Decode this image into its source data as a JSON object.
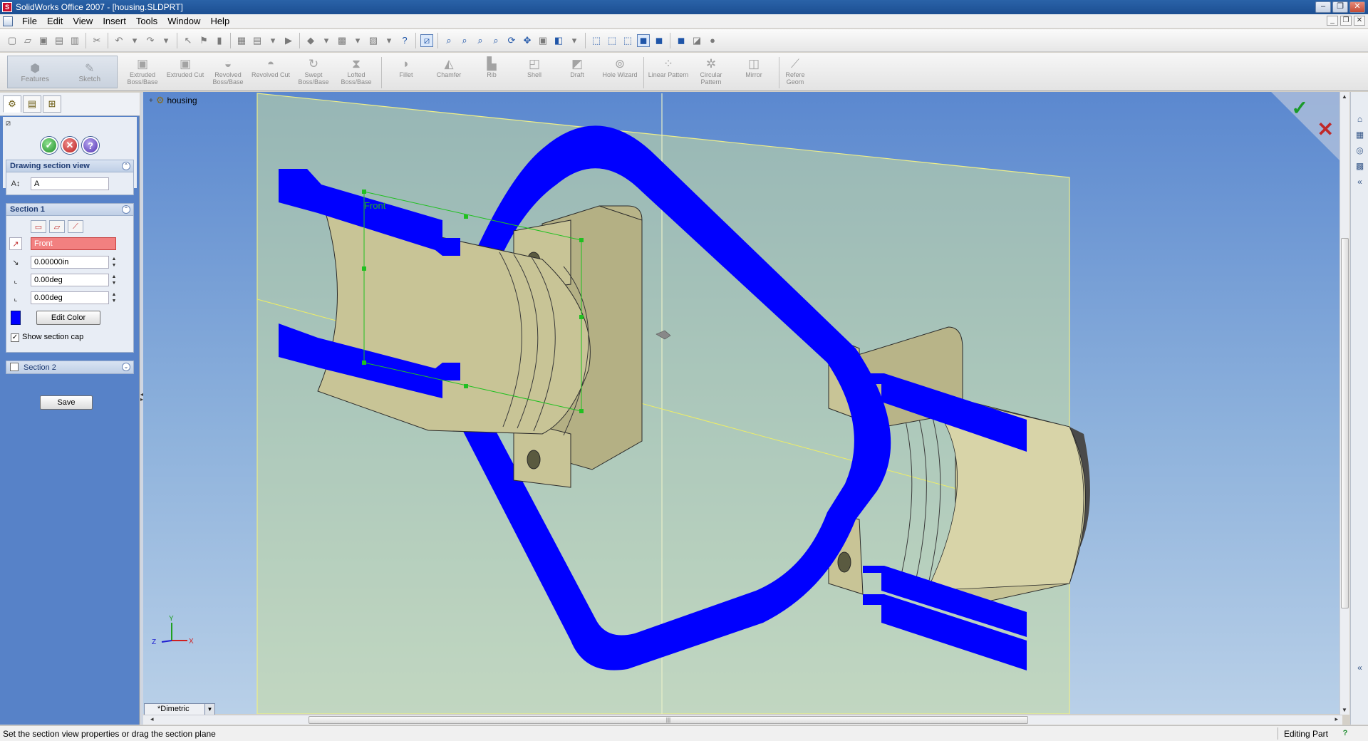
{
  "window": {
    "title": "SolidWorks Office 2007 - [housing.SLDPRT]",
    "app_icon": "solidworks-logo-icon",
    "controls": [
      "minimize-icon",
      "restore-icon",
      "close-icon"
    ]
  },
  "menu": {
    "items": [
      "File",
      "Edit",
      "View",
      "Insert",
      "Tools",
      "Window",
      "Help"
    ]
  },
  "command_manager": {
    "tabs": [
      {
        "label": "Features",
        "icon": "features-icon"
      },
      {
        "label": "Sketch",
        "icon": "sketch-icon"
      }
    ],
    "buttons": [
      {
        "label": "Extruded Boss/Base",
        "icon": "extruded-boss-icon"
      },
      {
        "label": "Extruded Cut",
        "icon": "extruded-cut-icon"
      },
      {
        "label": "Revolved Boss/Base",
        "icon": "revolved-boss-icon"
      },
      {
        "label": "Revolved Cut",
        "icon": "revolved-cut-icon"
      },
      {
        "label": "Swept Boss/Base",
        "icon": "swept-boss-icon"
      },
      {
        "label": "Lofted Boss/Base",
        "icon": "lofted-boss-icon"
      },
      {
        "label": "Fillet",
        "icon": "fillet-icon"
      },
      {
        "label": "Chamfer",
        "icon": "chamfer-icon"
      },
      {
        "label": "Rib",
        "icon": "rib-icon"
      },
      {
        "label": "Shell",
        "icon": "shell-icon"
      },
      {
        "label": "Draft",
        "icon": "draft-icon"
      },
      {
        "label": "Hole Wizard",
        "icon": "hole-wizard-icon"
      },
      {
        "label": "Linear Pattern",
        "icon": "linear-pattern-icon"
      },
      {
        "label": "Circular Pattern",
        "icon": "circular-pattern-icon"
      },
      {
        "label": "Mirror",
        "icon": "mirror-icon"
      },
      {
        "label": "Refere Geom",
        "icon": "reference-geometry-icon"
      }
    ]
  },
  "property_manager": {
    "header_icon": "section-view-icon",
    "drawing_section_view": {
      "title": "Drawing section view",
      "name_value": "A"
    },
    "section1": {
      "title": "Section 1",
      "reference_plane": "Front",
      "offset": "0.00000in",
      "rotation_x": "0.00deg",
      "rotation_y": "0.00deg",
      "edit_color_label": "Edit Color",
      "section_color": "#0000ff",
      "show_section_cap_label": "Show section cap",
      "show_section_cap_checked": true
    },
    "section2": {
      "title": "Section 2",
      "checked": false
    },
    "save_label": "Save"
  },
  "viewport": {
    "tree_root": "housing",
    "plane_label": "Front",
    "triad": {
      "x": "X",
      "y": "Y",
      "z": "Z"
    },
    "view_orientation": "*Dimetric",
    "section_cap_color": "#0000ff",
    "model_color": "#c8c496",
    "plane_color": "#c8dca0"
  },
  "status": {
    "message": "Set the section view properties or drag the section plane",
    "mode": "Editing Part"
  }
}
